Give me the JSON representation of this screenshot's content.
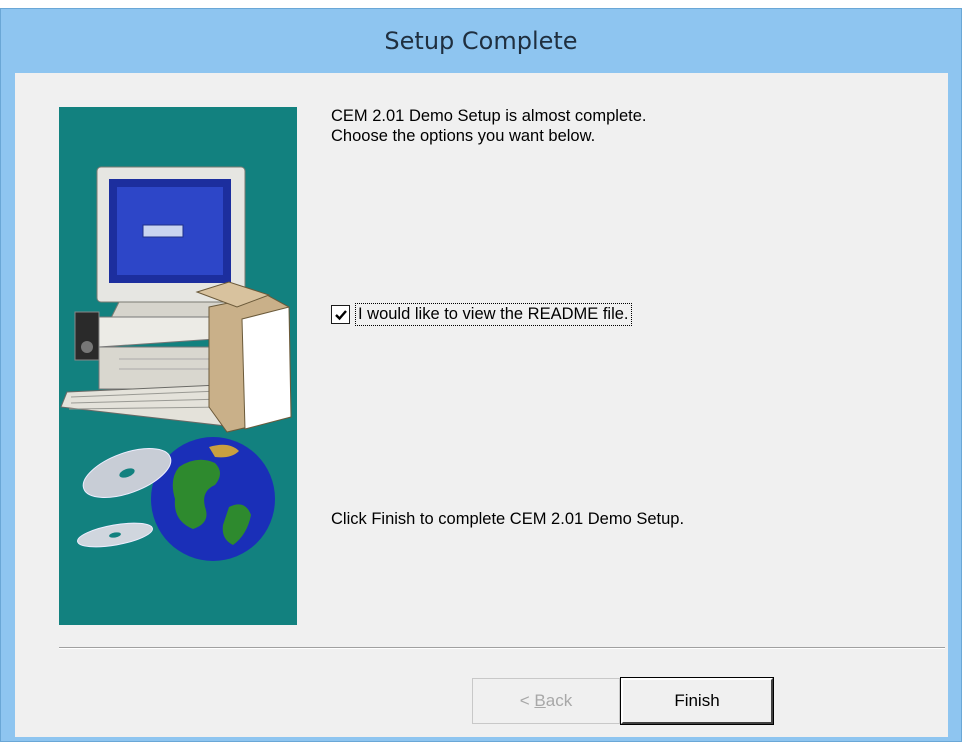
{
  "window": {
    "title": "Setup Complete"
  },
  "body": {
    "intro_line1": "CEM 2.01 Demo Setup is almost complete.",
    "intro_line2": "Choose the options you want below.",
    "readme_option": {
      "label": "I would like to view the README file.",
      "checked": true
    },
    "finish_message": "Click Finish to complete CEM 2.01 Demo Setup."
  },
  "buttons": {
    "back_prefix": "< ",
    "back_accel": "B",
    "back_rest": "ack",
    "back_enabled": false,
    "finish_label": "Finish"
  },
  "colors": {
    "titlebar": "#8ec5f0",
    "side_panel": "#12817f",
    "client": "#f0f0f0"
  },
  "icons": {
    "side_image": "computer-and-globe-illustration",
    "checkbox_mark": "check-icon"
  }
}
